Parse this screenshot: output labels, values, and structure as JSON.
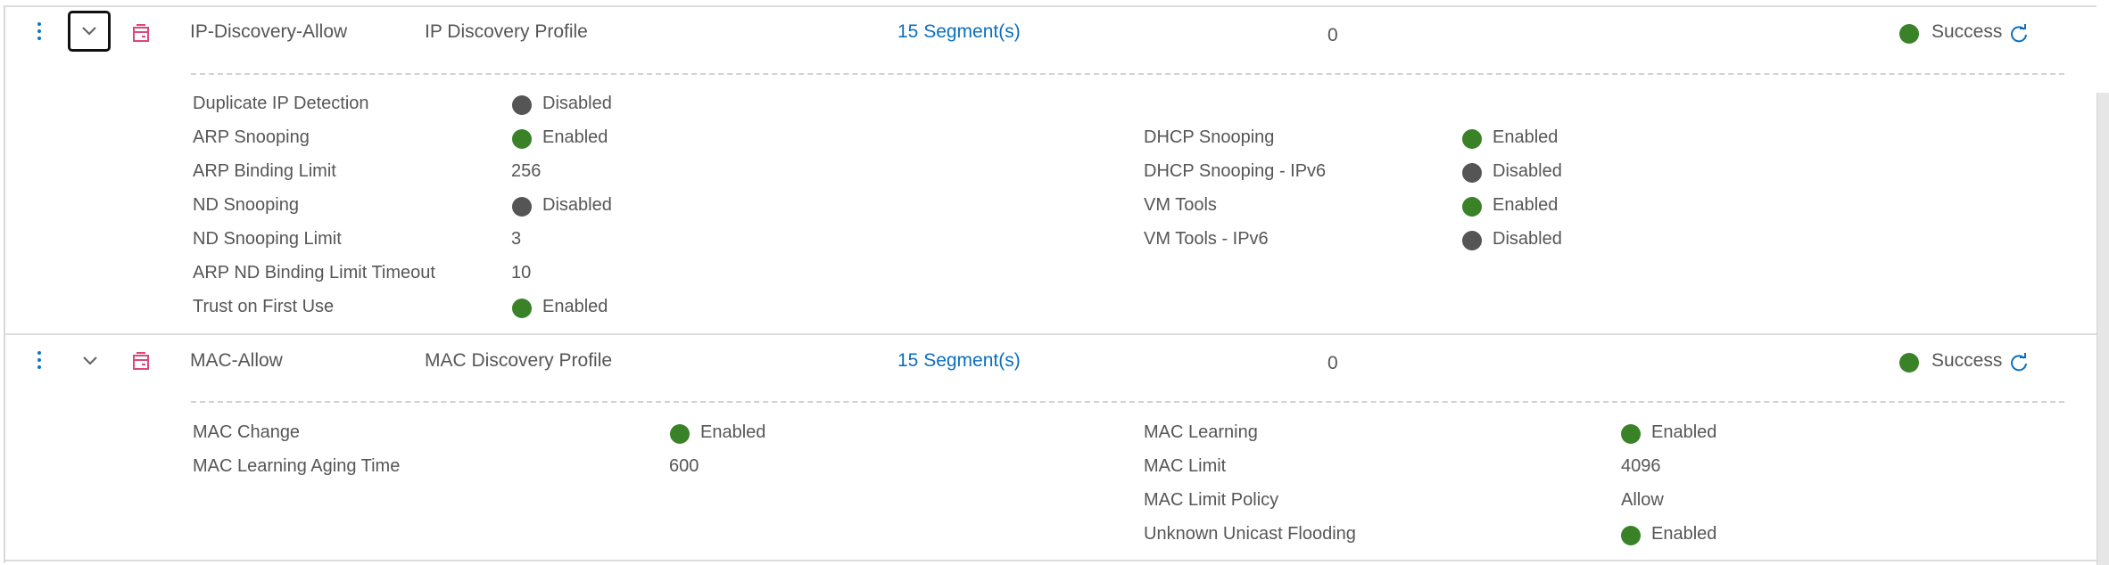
{
  "profiles": [
    {
      "name": "IP-Discovery-Allow",
      "type": "IP Discovery Profile",
      "segments": "15 Segment(s)",
      "count": "0",
      "status": "Success",
      "details_left": [
        {
          "label": "Duplicate IP Detection",
          "value": "Disabled",
          "state": "disabled"
        },
        {
          "label": "ARP Snooping",
          "value": "Enabled",
          "state": "enabled"
        },
        {
          "label": "ARP Binding Limit",
          "value": "256"
        },
        {
          "label": "ND Snooping",
          "value": "Disabled",
          "state": "disabled"
        },
        {
          "label": "ND Snooping Limit",
          "value": "3"
        },
        {
          "label": "ARP ND Binding Limit Timeout",
          "value": "10"
        },
        {
          "label": "Trust on First Use",
          "value": "Enabled",
          "state": "enabled"
        }
      ],
      "details_right": [
        {
          "label": "DHCP Snooping",
          "value": "Enabled",
          "state": "enabled"
        },
        {
          "label": "DHCP Snooping - IPv6",
          "value": "Disabled",
          "state": "disabled"
        },
        {
          "label": "VM Tools",
          "value": "Enabled",
          "state": "enabled"
        },
        {
          "label": "VM Tools - IPv6",
          "value": "Disabled",
          "state": "disabled"
        }
      ]
    },
    {
      "name": "MAC-Allow",
      "type": "MAC Discovery Profile",
      "segments": "15 Segment(s)",
      "count": "0",
      "status": "Success",
      "details_left": [
        {
          "label": "MAC Change",
          "value": "Enabled",
          "state": "enabled"
        },
        {
          "label": "MAC Learning Aging Time",
          "value": "600"
        }
      ],
      "details_right": [
        {
          "label": "MAC Learning",
          "value": "Enabled",
          "state": "enabled"
        },
        {
          "label": "MAC Limit",
          "value": "4096"
        },
        {
          "label": "MAC Limit Policy",
          "value": "Allow"
        },
        {
          "label": "Unknown Unicast Flooding",
          "value": "Enabled",
          "state": "enabled"
        }
      ]
    }
  ],
  "colors": {
    "enabled": "#3a8228",
    "disabled": "#555555",
    "link": "#0b6fbd",
    "profile_icon": "#e0457b"
  },
  "icons": {
    "actions": "kebab-menu-icon",
    "expand": "chevron-down-icon",
    "profile": "profile-type-icon",
    "refresh": "refresh-icon"
  }
}
